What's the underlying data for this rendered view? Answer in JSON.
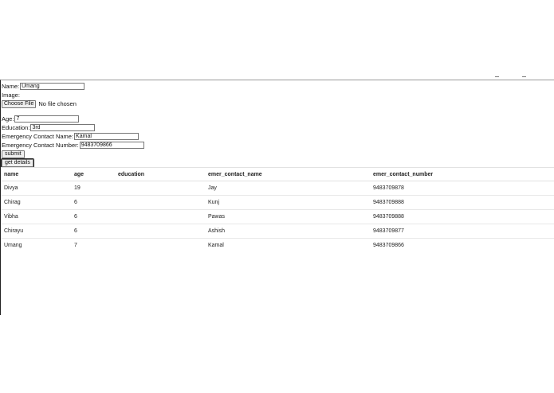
{
  "form": {
    "name_label": "Name:",
    "name_value": "Umang",
    "image_label": "Image:",
    "choose_file_label": "Choose File",
    "file_status": "No file chosen",
    "age_label": "Age:",
    "age_value": "7",
    "education_label": "Education:",
    "education_value": "3rd",
    "emer_name_label": "Emergency Contact Name:",
    "emer_name_value": "Kamal",
    "emer_number_label": "Emergency Contact Number:",
    "emer_number_value": "9483709866",
    "submit_label": "submit",
    "get_details_label": "get details"
  },
  "table": {
    "headers": [
      "name",
      "age",
      "education",
      "emer_contact_name",
      "emer_contact_number"
    ],
    "rows": [
      [
        "Divya",
        "19",
        "",
        "Jay",
        "9483709878"
      ],
      [
        "Chirag",
        "6",
        "",
        "Kunj",
        "9483709888"
      ],
      [
        "Vibha",
        "6",
        "",
        "Pawas",
        "9483709888"
      ],
      [
        "Chirayu",
        "6",
        "",
        "Ashish",
        "9483709877"
      ],
      [
        "Umang",
        "7",
        "",
        "Kamal",
        "9483709866"
      ]
    ]
  }
}
